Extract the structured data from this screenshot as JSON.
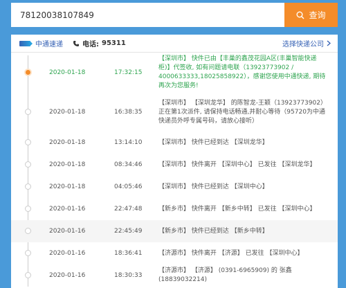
{
  "search": {
    "value": "78120038107849",
    "button_label": "查询"
  },
  "carrier": {
    "name": "中通速递",
    "phone_label": "电话:",
    "phone_number": "95311",
    "select_link": "选择快递公司"
  },
  "events": [
    {
      "date": "2020-01-18",
      "time": "17:32:15",
      "desc": "【深圳市】 快件已由【丰巢的鑫茂花园A区(丰巢智能快递柜)】代签收, 如有问题请电联（13923773902 / 4000633333,18025858922），感谢您使用中通快递, 期待再次为您服务!"
    },
    {
      "date": "2020-01-18",
      "time": "16:38:35",
      "desc": "【深圳市】 【深圳龙华】 的陈智龙-王颖（13923773902） 正在第1次派件, 请保持电话畅通,并耐心等待（95720为中通快递员外呼专属号码，请放心接听）"
    },
    {
      "date": "2020-01-18",
      "time": "13:14:10",
      "desc": "【深圳市】 快件已经到达 【深圳龙华】"
    },
    {
      "date": "2020-01-18",
      "time": "08:34:46",
      "desc": "【深圳市】 快件离开 【深圳中心】 已发往 【深圳龙华】"
    },
    {
      "date": "2020-01-18",
      "time": "04:05:46",
      "desc": "【深圳市】 快件已经到达 【深圳中心】"
    },
    {
      "date": "2020-01-16",
      "time": "22:47:48",
      "desc": "【新乡市】 快件离开 【新乡中转】 已发往 【深圳中心】"
    },
    {
      "date": "2020-01-16",
      "time": "22:45:49",
      "desc": "【新乡市】 快件已经到达 【新乡中转】"
    },
    {
      "date": "2020-01-16",
      "time": "18:36:41",
      "desc": "【济源市】 快件离开 【济源】 已发往 【深圳中心】"
    },
    {
      "date": "2020-01-16",
      "time": "18:30:33",
      "desc": "【济源市】 【济源】 (0391-6965909) 的 张鑫 (18839032214)"
    }
  ]
}
